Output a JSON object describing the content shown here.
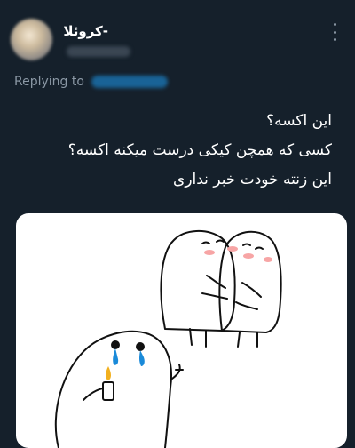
{
  "tweet": {
    "display_name": "-کروئلا",
    "avatar": "blurred-avatar",
    "replying_label": "Replying to",
    "text_lines": [
      "این اکسه؟",
      "کسی که همچن کیکی درست میکنه اکسه؟",
      "این زنته خودت خبر نداری"
    ],
    "media": {
      "description_icon": "cartoon-hug-meme",
      "colors": {
        "tear": "#1a8ad9",
        "blush": "#f7a5a5",
        "flame": "#f2b01e"
      }
    }
  },
  "theme": {
    "background": "#15202b",
    "secondary_text": "#8b98a5",
    "accent": "#1d9bf0"
  }
}
